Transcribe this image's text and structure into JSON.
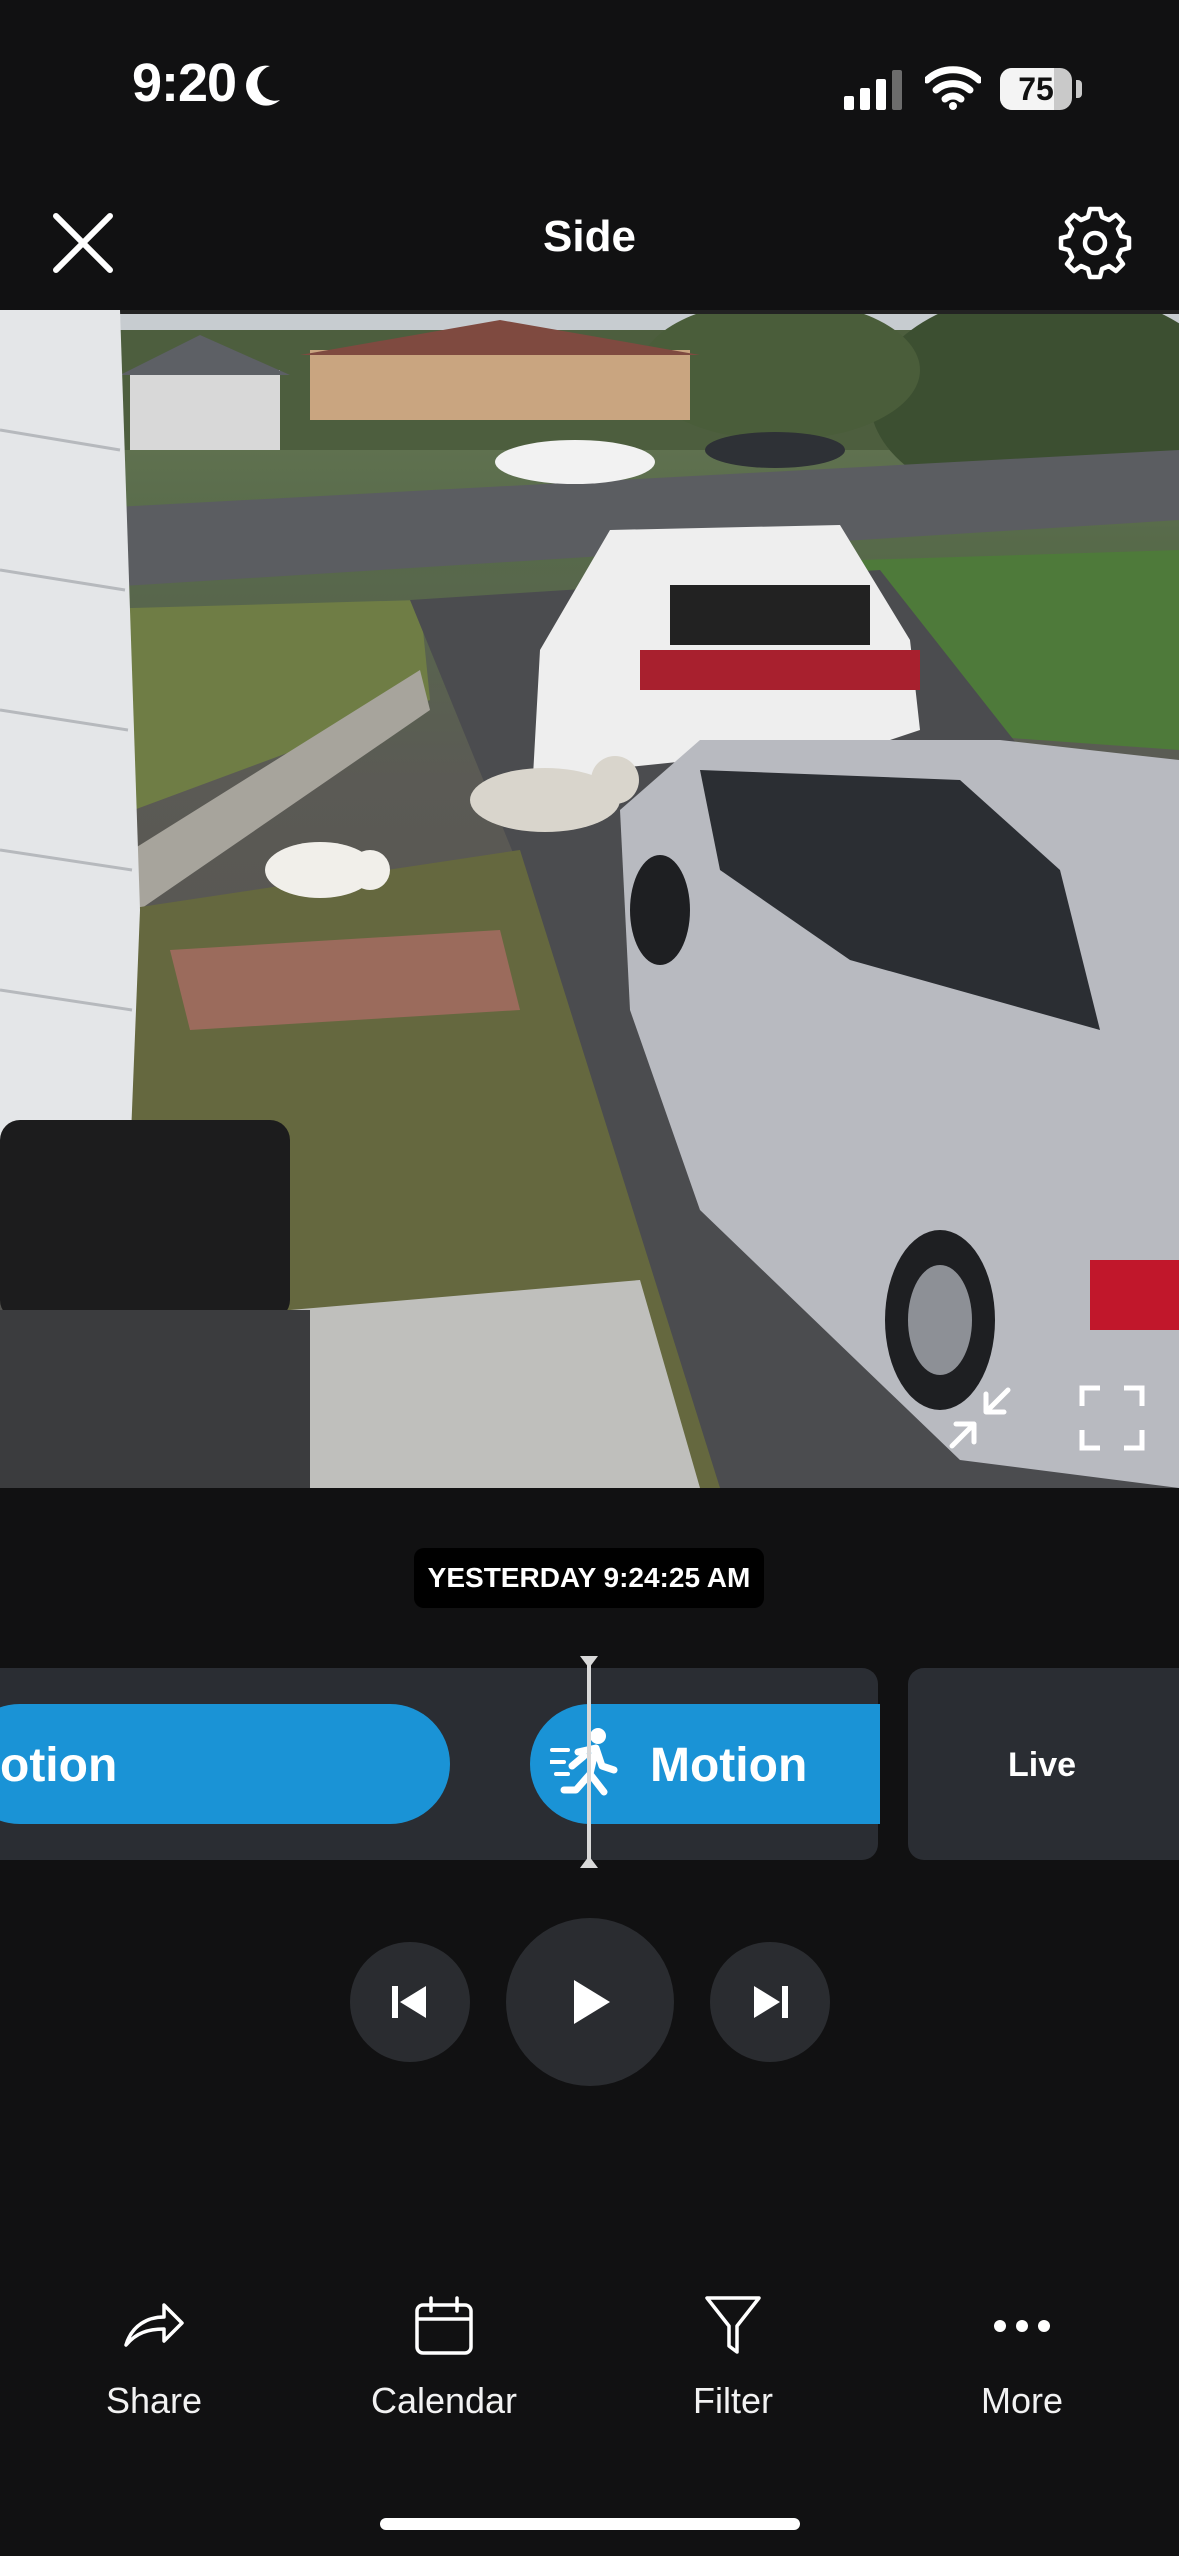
{
  "status_bar": {
    "time": "9:20",
    "battery_percent": "75"
  },
  "header": {
    "title": "Side"
  },
  "video": {
    "timestamp": "YESTERDAY 9:24:25 AM"
  },
  "timeline": {
    "events": [
      {
        "label": "otion"
      },
      {
        "label": "Motion"
      }
    ],
    "live_label": "Live"
  },
  "bottom_bar": [
    {
      "label": "Share",
      "icon": "share-icon"
    },
    {
      "label": "Calendar",
      "icon": "calendar-icon"
    },
    {
      "label": "Filter",
      "icon": "filter-icon"
    },
    {
      "label": "More",
      "icon": "more-icon"
    }
  ],
  "colors": {
    "accent": "#1a93d6",
    "background": "#111112",
    "panel": "#2a2d33"
  }
}
